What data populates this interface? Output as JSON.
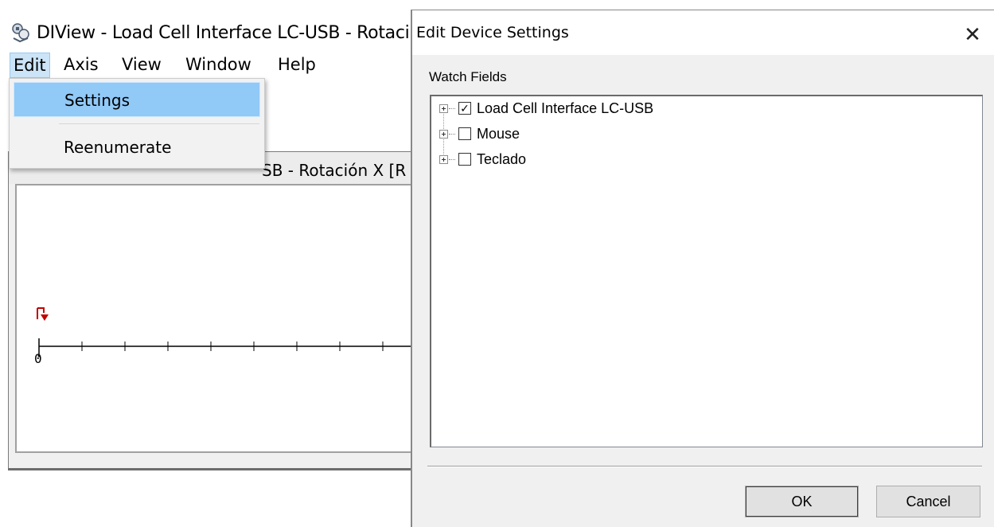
{
  "app": {
    "title": "DIView - Load Cell Interface LC-USB - Rotaci",
    "menu": [
      "Edit",
      "Axis",
      "View",
      "Window",
      "Help"
    ],
    "active_menu": "Edit",
    "dropdown": [
      "Settings",
      "Reenumerate"
    ],
    "child_window_title": "SB - Rotación X [R",
    "axis_zero_label": "0"
  },
  "dialog": {
    "title": "Edit Device Settings",
    "close_glyph": "✕",
    "group_label": "Watch Fields",
    "tree": [
      {
        "label": "Load Cell Interface LC-USB",
        "checked": true
      },
      {
        "label": "Mouse",
        "checked": false
      },
      {
        "label": "Teclado",
        "checked": false
      }
    ],
    "ok_label": "OK",
    "cancel_label": "Cancel"
  },
  "colors": {
    "menu_highlight": "#91c9f7",
    "marker_red": "#c00000"
  }
}
